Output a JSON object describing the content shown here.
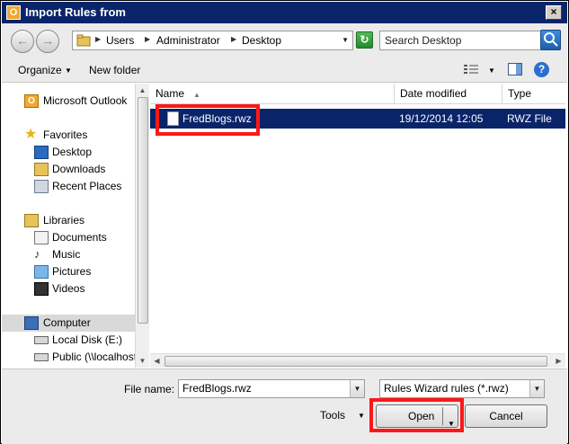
{
  "window": {
    "title": "Import Rules from",
    "app_icon_letter": "O"
  },
  "navigation": {
    "breadcrumbs": [
      "Users",
      "Administrator",
      "Desktop"
    ],
    "search_placeholder": "Search Desktop"
  },
  "toolbar": {
    "organize_label": "Organize",
    "new_folder_label": "New folder"
  },
  "sidebar": {
    "items": [
      {
        "label": "Microsoft Outlook",
        "icon": "outlook-icon"
      },
      {
        "label": "Favorites",
        "icon": "star-icon"
      },
      {
        "label": "Desktop",
        "icon": "desktop-icon"
      },
      {
        "label": "Downloads",
        "icon": "downloads-icon"
      },
      {
        "label": "Recent Places",
        "icon": "recent-places-icon"
      },
      {
        "label": "Libraries",
        "icon": "libraries-icon"
      },
      {
        "label": "Documents",
        "icon": "documents-icon"
      },
      {
        "label": "Music",
        "icon": "music-icon"
      },
      {
        "label": "Pictures",
        "icon": "pictures-icon"
      },
      {
        "label": "Videos",
        "icon": "videos-icon"
      },
      {
        "label": "Computer",
        "icon": "computer-icon"
      },
      {
        "label": "Local Disk (E:)",
        "icon": "drive-icon"
      },
      {
        "label": "Public (\\\\localhost\\",
        "icon": "network-drive-icon"
      }
    ]
  },
  "file_list": {
    "columns": [
      "Name",
      "Date modified",
      "Type"
    ],
    "files": [
      {
        "name": "FredBlogs.rwz",
        "date_modified": "19/12/2014 12:05",
        "type": "RWZ File",
        "selected": true
      }
    ]
  },
  "footer": {
    "file_name_label": "File name:",
    "file_name_value": "FredBlogs.rwz",
    "file_type_value": "Rules Wizard rules (*.rwz)",
    "tools_label": "Tools",
    "open_label": "Open",
    "cancel_label": "Cancel"
  },
  "colors": {
    "selection": "#0a246a",
    "highlight_box": "#ff1717",
    "title_bar": "#0a246a"
  }
}
